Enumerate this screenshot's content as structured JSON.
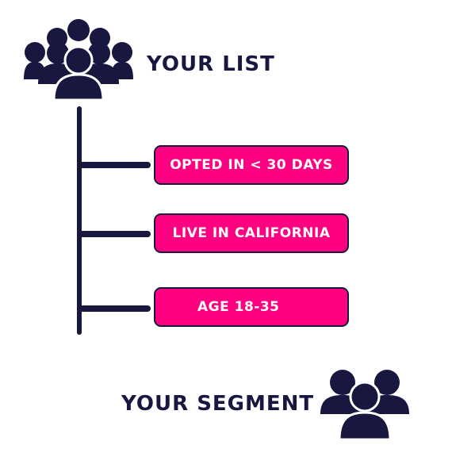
{
  "colors": {
    "navy": "#171740",
    "pink": "#ff0080",
    "white": "#ffffff"
  },
  "header": {
    "icon": "people-group-icon",
    "title": "YOUR LIST"
  },
  "filters": [
    {
      "label": "OPTED IN < 30 DAYS"
    },
    {
      "label": "LIVE IN CALIFORNIA"
    },
    {
      "label": "AGE 18-35"
    }
  ],
  "footer": {
    "title": "YOUR SEGMENT",
    "icon": "people-group-icon"
  }
}
